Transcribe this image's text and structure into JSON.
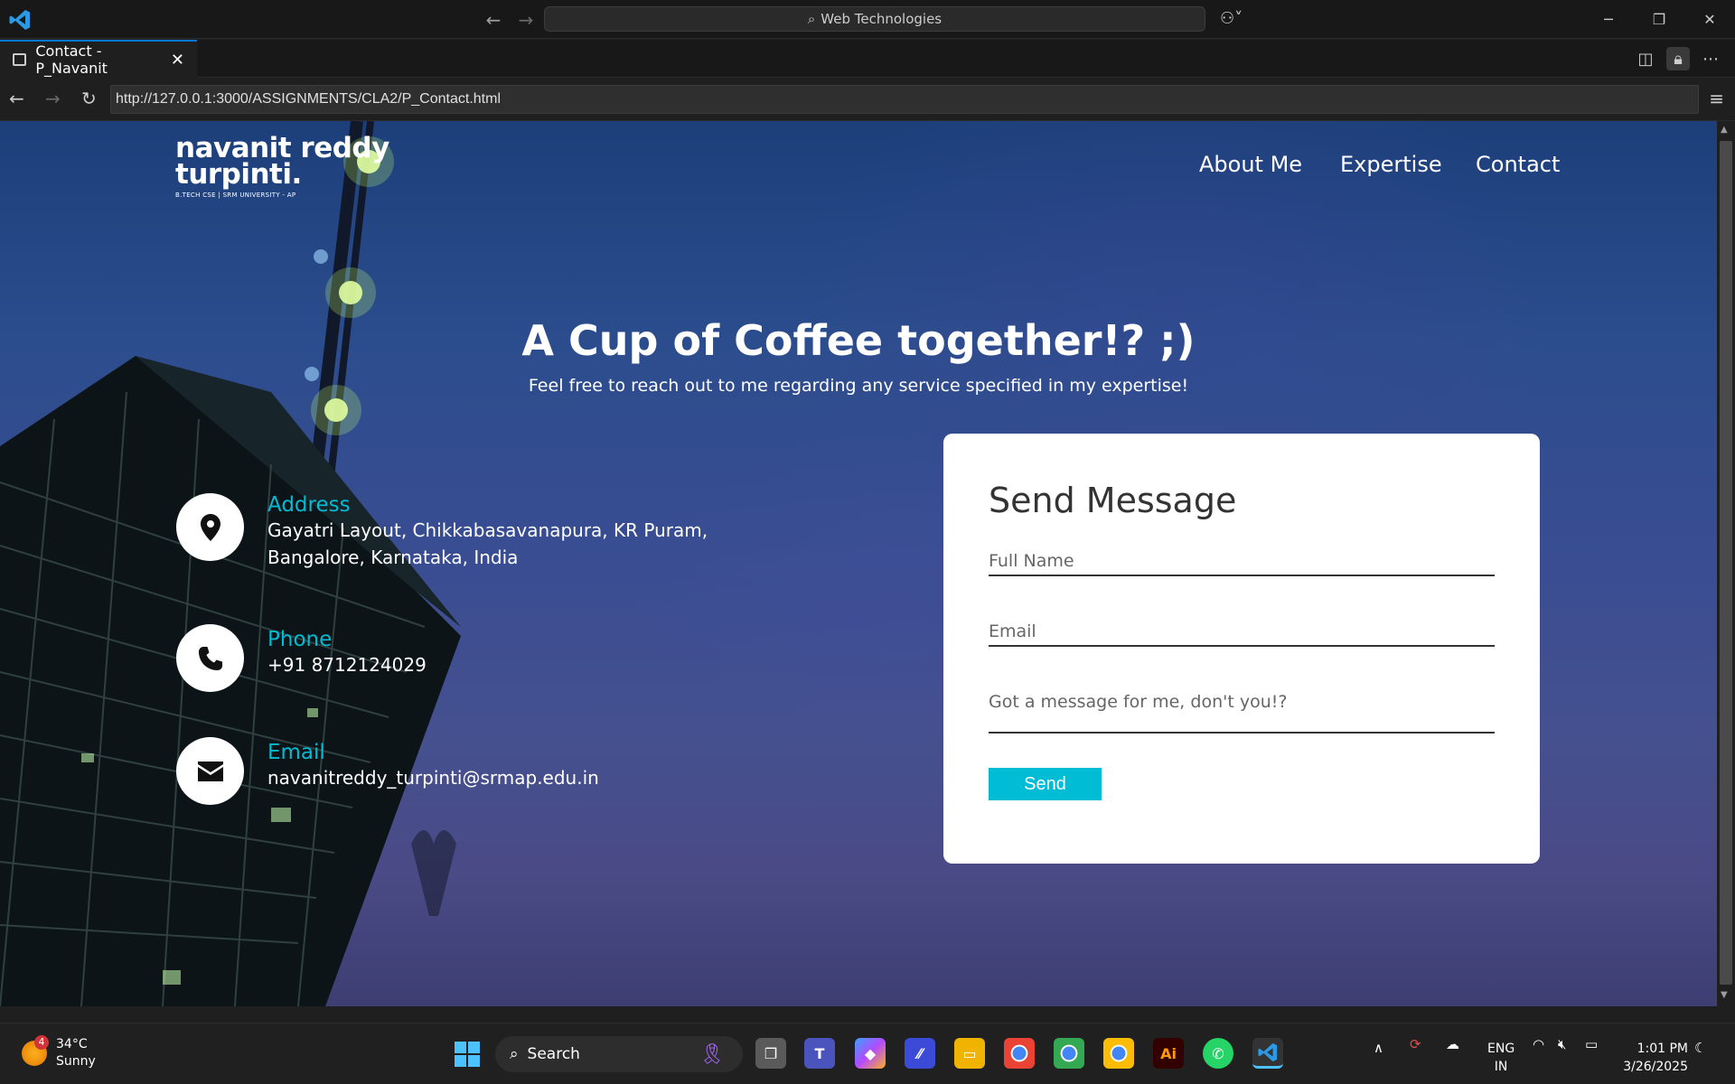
{
  "window": {
    "command_center": "Web Technologies",
    "controls": [
      "minimize",
      "restore",
      "close"
    ]
  },
  "tab": {
    "title": "Contact - P_Navanit"
  },
  "browser": {
    "url": "http://127.0.0.1:3000/ASSIGNMENTS/CLA2/P_Contact.html"
  },
  "site": {
    "logo_line1": "navanit reddy",
    "logo_line2": "turpinti.",
    "logo_tagline": "B.TECH CSE | SRM UNIVERSITY - AP",
    "nav": [
      "About Me",
      "Expertise",
      "Contact"
    ],
    "hero_title": "A Cup of Coffee together!? ;)",
    "hero_subtitle": "Feel free to reach out to me regarding any service specified in my expertise!",
    "contact": [
      {
        "label": "Address",
        "value_line1": "Gayatri Layout, Chikkabasavanapura, KR Puram,",
        "value_line2": "Bangalore, Karnataka, India",
        "icon": "map-pin-icon"
      },
      {
        "label": "Phone",
        "value_line1": "+91 8712124029",
        "icon": "phone-icon"
      },
      {
        "label": "Email",
        "value_line1": "navanitreddy_turpinti@srmap.edu.in",
        "icon": "envelope-icon"
      }
    ],
    "form": {
      "title": "Send Message",
      "name_placeholder": "Full Name",
      "email_placeholder": "Email",
      "message_placeholder": "Got a message for me, don't you!?",
      "send_label": "Send"
    },
    "accent_color": "#00bcd4"
  },
  "taskbar": {
    "weather_temp": "34°C",
    "weather_desc": "Sunny",
    "weather_badge": "4",
    "search_label": "Search",
    "lang_line1": "ENG",
    "lang_line2": "IN",
    "time": "1:01 PM",
    "date": "3/26/2025"
  }
}
